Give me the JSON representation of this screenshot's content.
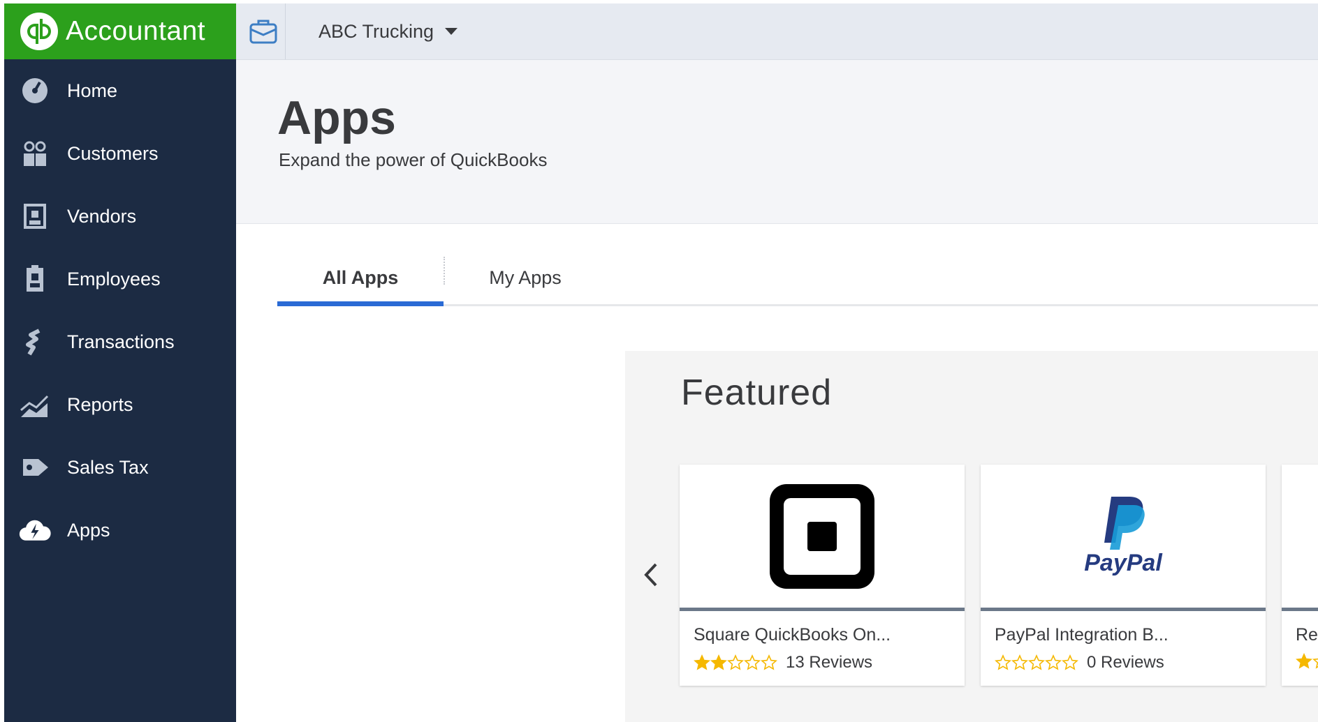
{
  "brand": {
    "name": "Accountant",
    "color": "#2ca01c"
  },
  "sidebar": {
    "items": [
      {
        "label": "Home",
        "icon": "dashboard-gauge-icon"
      },
      {
        "label": "Customers",
        "icon": "customers-icon"
      },
      {
        "label": "Vendors",
        "icon": "vendors-icon"
      },
      {
        "label": "Employees",
        "icon": "employees-icon"
      },
      {
        "label": "Transactions",
        "icon": "transactions-icon"
      },
      {
        "label": "Reports",
        "icon": "reports-icon"
      },
      {
        "label": "Sales Tax",
        "icon": "sales-tax-icon"
      },
      {
        "label": "Apps",
        "icon": "apps-cloud-icon"
      }
    ],
    "bg_color": "#1c2b43"
  },
  "topbar": {
    "company": "ABC Trucking",
    "icon": "briefcase-icon"
  },
  "header": {
    "title": "Apps",
    "subtitle": "Expand the power of QuickBooks"
  },
  "tabs": [
    {
      "label": "All Apps",
      "active": true
    },
    {
      "label": "My Apps",
      "active": false
    }
  ],
  "featured": {
    "title": "Featured",
    "cards": [
      {
        "name": "Square QuickBooks On...",
        "rating": 2,
        "reviews": "13 Reviews",
        "logo": "square-logo"
      },
      {
        "name": "PayPal Integration B...",
        "rating": 0,
        "reviews": "0 Reviews",
        "logo": "paypal-logo",
        "logo_text": "PayPal"
      },
      {
        "name": "Re",
        "rating": 1,
        "reviews": "",
        "logo": ""
      }
    ]
  },
  "colors": {
    "accent_blue": "#2a6bd5",
    "star_gold": "#f5b800"
  }
}
